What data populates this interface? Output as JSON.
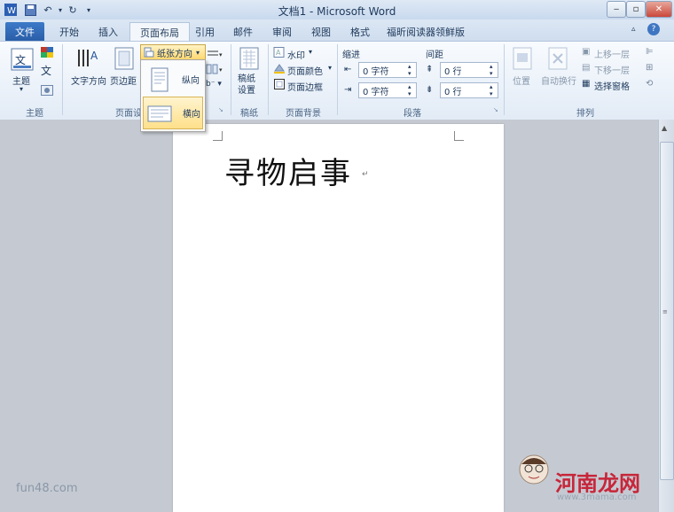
{
  "window": {
    "title": "文档1 - Microsoft Word"
  },
  "tabs": [
    "文件",
    "开始",
    "插入",
    "页面布局",
    "引用",
    "邮件",
    "审阅",
    "视图",
    "格式",
    "福昕阅读器领鲜版"
  ],
  "active_tab": "页面布局",
  "ribbon": {
    "theme_group": {
      "label": "主题",
      "theme_button": "主题"
    },
    "page_setup_group": {
      "label": "页面设置",
      "text_direction": "文字方向",
      "margins": "页边距",
      "orientation": "纸张方向"
    },
    "orientation_menu": {
      "portrait": "纵向",
      "landscape": "横向"
    },
    "draft_group": {
      "label": "稿纸",
      "draft_button": "稿纸\n设置"
    },
    "background_group": {
      "label": "页面背景",
      "watermark": "水印",
      "page_color": "页面颜色",
      "page_border": "页面边框"
    },
    "paragraph_group": {
      "label": "段落",
      "indent": "缩进",
      "spacing": "间距",
      "indent_left": "0 字符",
      "indent_right": "0 字符",
      "spacing_before": "0 行",
      "spacing_after": "0 行"
    },
    "arrange_group": {
      "label": "排列",
      "position": "位置",
      "wrap": "自动换行",
      "bring_forward": "上移一层",
      "send_backward": "下移一层",
      "selection_pane": "选择窗格"
    }
  },
  "document": {
    "heading": "寻物启事"
  },
  "watermarks": {
    "left": "fun48.com",
    "right": "河南龙网",
    "url": "www.3mama.com"
  }
}
